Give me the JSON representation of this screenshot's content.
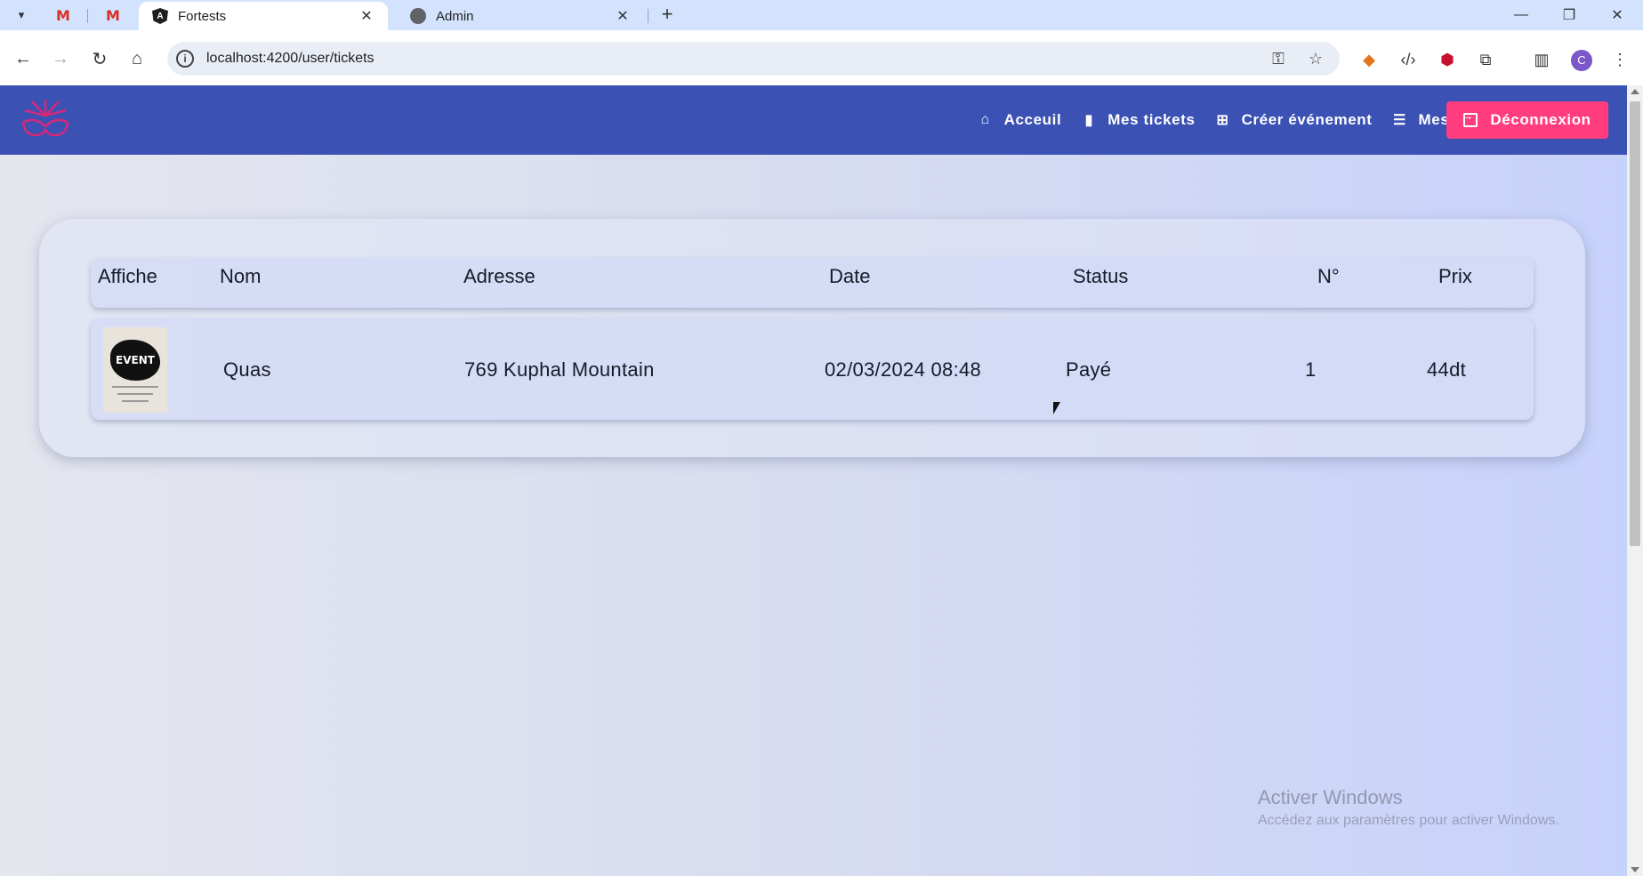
{
  "browser": {
    "tabs": [
      {
        "title": "Fortests",
        "active": true
      },
      {
        "title": "Admin",
        "active": false
      }
    ],
    "pinned": [
      "gmail-icon",
      "gmail-icon"
    ],
    "url": "localhost:4200/user/tickets",
    "profile_initial": "C"
  },
  "nav": {
    "links": [
      {
        "label": "Acceuil",
        "icon": "home-icon"
      },
      {
        "label": "Mes tickets",
        "icon": "film-icon"
      },
      {
        "label": "Créer événement",
        "icon": "plus-square-icon"
      },
      {
        "label": "Mes evenements",
        "icon": "list-icon"
      }
    ],
    "logout_label": "Déconnexion",
    "colors": {
      "nav_bg": "#3c51b4",
      "logout_bg": "#ff3d7f"
    }
  },
  "table": {
    "headers": [
      "Affiche",
      "Nom",
      "Adresse",
      "Date",
      "Status",
      "N°",
      "Prix"
    ],
    "rows": [
      {
        "poster_text": "EVENT",
        "nom": "Quas",
        "adresse": "769 Kuphal Mountain",
        "date": "02/03/2024 08:48",
        "status": "Payé",
        "numero": "1",
        "prix": "44dt"
      }
    ]
  },
  "watermark": {
    "title": "Activer Windows",
    "subtitle": "Accédez aux paramètres pour activer Windows."
  }
}
